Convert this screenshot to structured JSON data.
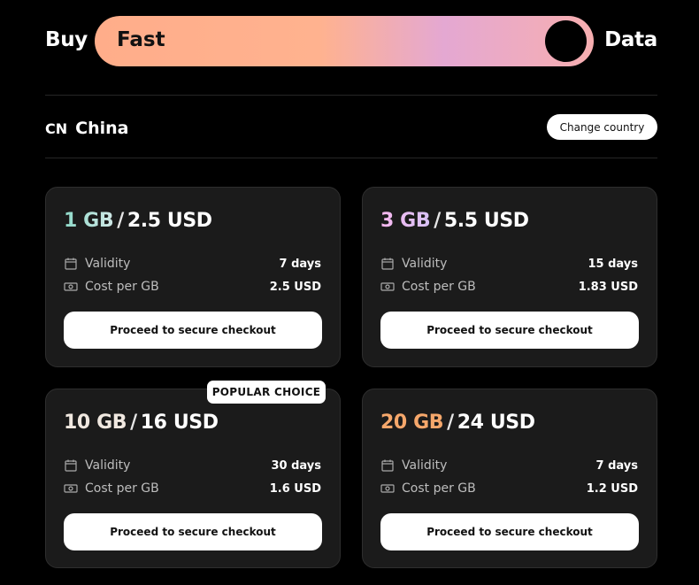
{
  "hero": {
    "left_word": "Buy",
    "pill_text": "Fast",
    "right_word": "Data"
  },
  "country": {
    "code": "CN",
    "name": "China",
    "change_label": "Change country"
  },
  "labels": {
    "validity": "Validity",
    "cost_per_gb": "Cost per GB",
    "checkout": "Proceed to secure checkout"
  },
  "badge": "POPULAR CHOICE",
  "plans": [
    {
      "amount": "1 GB",
      "price": "2.5 USD",
      "validity": "7 days",
      "cost_per_gb": "2.5 USD",
      "accent": "#8ed9c8"
    },
    {
      "amount": "3 GB",
      "price": "5.5 USD",
      "validity": "15 days",
      "cost_per_gb": "1.83 USD",
      "accent": "#f7b7ef"
    },
    {
      "amount": "10 GB",
      "price": "16 USD",
      "validity": "30 days",
      "cost_per_gb": "1.6 USD",
      "accent": "#f0e8e0"
    },
    {
      "amount": "20 GB",
      "price": "24 USD",
      "validity": "7 days",
      "cost_per_gb": "1.2 USD",
      "accent": "#f5a76b"
    }
  ],
  "icons": {
    "validity": "calendar-icon",
    "cost": "banknote-icon"
  }
}
